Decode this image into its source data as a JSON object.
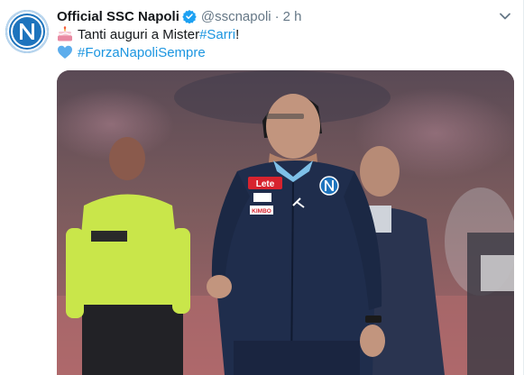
{
  "tweet": {
    "account_name": "Official SSC Napoli",
    "handle": "@sscnapoli",
    "separator": "·",
    "time": "2 h",
    "line1_text": "Tanti auguri a Mister ",
    "line1_hashtag": "#Sarri",
    "line1_suffix": "!",
    "line2_hashtag": "#ForzaNapoliSempre"
  },
  "icons": {
    "avatar": "napoli-logo",
    "verified": "verified-badge-icon",
    "caret": "chevron-down-icon",
    "line1_emoji": "birthday-cake-icon",
    "line2_emoji": "blue-heart-icon"
  },
  "colors": {
    "text": "#14171a",
    "secondary": "#657786",
    "link": "#1b95e0",
    "verified": "#1da1f2",
    "napoli_blue": "#1a6fb3"
  },
  "photo": {
    "jacket_sponsor": "Lete",
    "jacket_patch": "KIMBO"
  }
}
